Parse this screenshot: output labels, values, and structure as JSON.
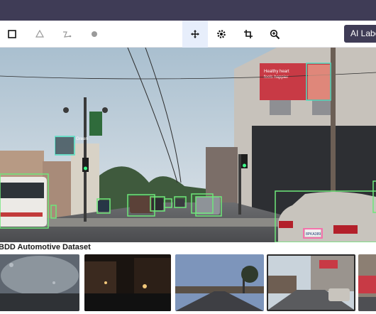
{
  "toolbar": {
    "tools": [
      {
        "name": "rectangle-tool",
        "icon": "square-icon"
      },
      {
        "name": "polygon-tool",
        "icon": "triangle-icon"
      },
      {
        "name": "polyline-tool",
        "icon": "polyline-icon"
      },
      {
        "name": "point-tool",
        "icon": "circle-dot-icon"
      },
      {
        "name": "pan-tool",
        "icon": "move-arrows-icon",
        "active": true
      },
      {
        "name": "settings-tool",
        "icon": "gear-icon"
      },
      {
        "name": "crop-tool",
        "icon": "crop-icon"
      },
      {
        "name": "zoom-tool",
        "icon": "zoom-in-icon"
      }
    ],
    "ai_button_label": "AI Label"
  },
  "scene": {
    "billboard_text_line1": "Healthy heart",
    "billboard_text_line2": "feels happier",
    "street_sign_text": "Green",
    "bus_text": "",
    "annotation_color_vehicle": "#6ee87a",
    "annotation_color_face": "#4fe0c2",
    "annotation_color_plate": "#ff5fa8",
    "license_plate_text": "8PKA389"
  },
  "gallery": {
    "title": "BDD Automotive Dataset",
    "thumbnails": [
      {
        "name": "thumbnail-rainy-windshield",
        "selected": false
      },
      {
        "name": "thumbnail-night-street",
        "selected": false
      },
      {
        "name": "thumbnail-highway-dusk",
        "selected": false
      },
      {
        "name": "thumbnail-city-intersection",
        "selected": true
      },
      {
        "name": "thumbnail-partial",
        "selected": false
      }
    ]
  },
  "colors": {
    "topbar": "#3f3c56",
    "active_tool_bg": "#e7eefb",
    "accent": "#3f3c56"
  }
}
